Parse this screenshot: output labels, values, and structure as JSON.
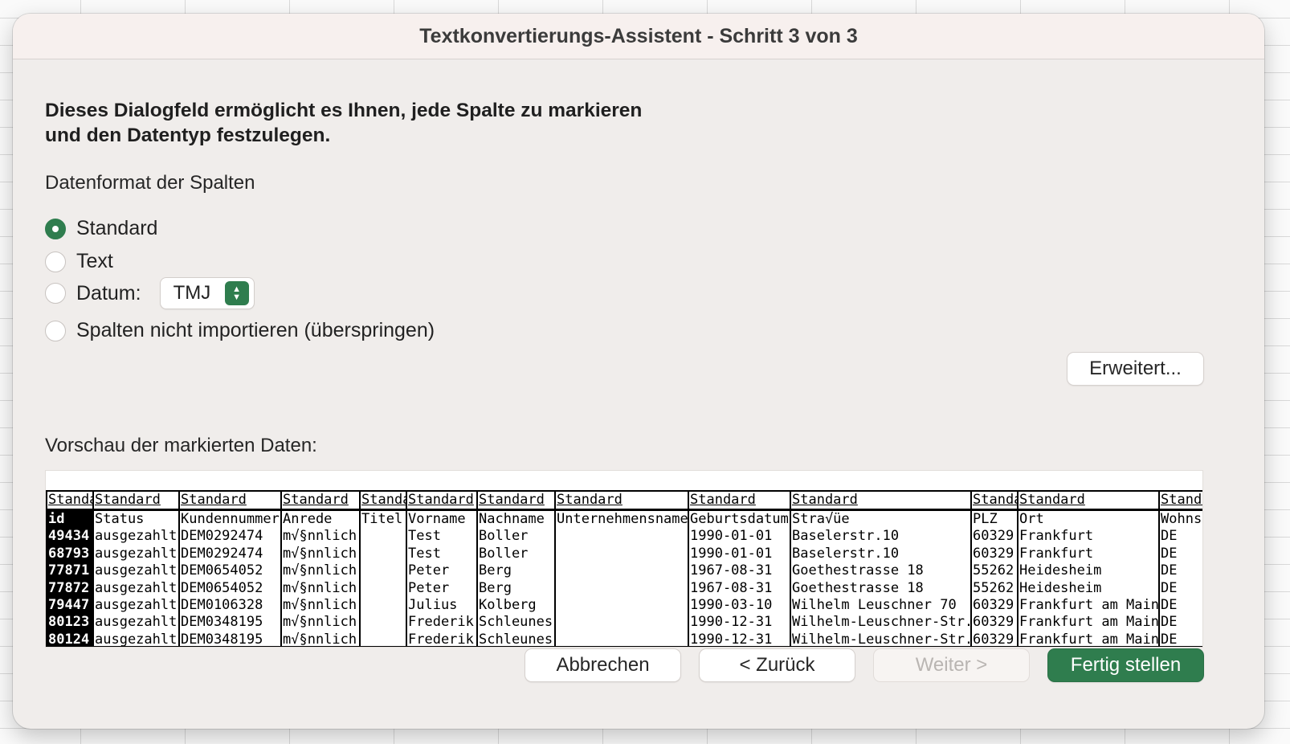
{
  "dialog": {
    "title": "Textkonvertierungs-Assistent - Schritt 3 von 3",
    "heading_line1": "Dieses Dialogfeld ermöglicht es Ihnen, jede Spalte zu markieren",
    "heading_line2": "und den Datentyp festzulegen.",
    "format_section_label": "Datenformat der Spalten",
    "options": [
      {
        "label": "Standard",
        "checked": true
      },
      {
        "label": "Text",
        "checked": false
      },
      {
        "label": "Datum:",
        "checked": false
      },
      {
        "label": "Spalten nicht importieren (überspringen)",
        "checked": false
      }
    ],
    "date_format_value": "TMJ",
    "advanced_button": "Erweitert...",
    "preview_label": "Vorschau der markierten Daten:",
    "buttons": {
      "cancel": "Abbrechen",
      "back": "< Zurück",
      "next": "Weiter >",
      "finish": "Fertig stellen"
    },
    "accent_color": "#2f7d4e"
  },
  "preview": {
    "columns": [
      {
        "type": "Standard",
        "cells": [
          "id",
          "49434",
          "68793",
          "77871",
          "77872",
          "79447",
          "80123",
          "80124"
        ]
      },
      {
        "type": "Standard",
        "cells": [
          "Status",
          "ausgezahlt",
          "ausgezahlt",
          "ausgezahlt",
          "ausgezahlt",
          "ausgezahlt",
          "ausgezahlt",
          "ausgezahlt"
        ]
      },
      {
        "type": "Standard",
        "cells": [
          "Kundennummer",
          "DEM0292474",
          "DEM0292474",
          "DEM0654052",
          "DEM0654052",
          "DEM0106328",
          "DEM0348195",
          "DEM0348195"
        ]
      },
      {
        "type": "Standard",
        "cells": [
          "Anrede",
          "m√§nnlich",
          "m√§nnlich",
          "m√§nnlich",
          "m√§nnlich",
          "m√§nnlich",
          "m√§nnlich",
          "m√§nnlich"
        ]
      },
      {
        "type": "Standard",
        "cells": [
          "Titel",
          "",
          "",
          "",
          "",
          "",
          "",
          ""
        ]
      },
      {
        "type": "Standard",
        "cells": [
          "Vorname",
          "Test",
          "Test",
          "Peter",
          "Peter",
          "Julius",
          "Frederik",
          "Frederik"
        ]
      },
      {
        "type": "Standard",
        "cells": [
          "Nachname",
          "Boller",
          "Boller",
          "Berg",
          "Berg",
          "Kolberg",
          "Schleunes",
          "Schleunes"
        ]
      },
      {
        "type": "Standard",
        "cells": [
          "Unternehmensname",
          "",
          "",
          "",
          "",
          "",
          "",
          ""
        ]
      },
      {
        "type": "Standard",
        "cells": [
          "Geburtsdatum",
          "1990-01-01",
          "1990-01-01",
          "1967-08-31",
          "1967-08-31",
          "1990-03-10",
          "1990-12-31",
          "1990-12-31"
        ]
      },
      {
        "type": "Standard",
        "cells": [
          "Stra√üe",
          "Baselerstr.10",
          "Baselerstr.10",
          "Goethestrasse 18",
          "Goethestrasse 18",
          "Wilhelm Leuschner 70",
          "Wilhelm-Leuschner-Str.",
          "Wilhelm-Leuschner-Str."
        ]
      },
      {
        "type": "Standard",
        "cells": [
          "PLZ",
          "60329",
          "60329",
          "55262",
          "55262",
          "60329",
          "60329",
          "60329"
        ]
      },
      {
        "type": "Standard",
        "cells": [
          "Ort",
          "Frankfurt",
          "Frankfurt",
          "Heidesheim",
          "Heidesheim",
          "Frankfurt am Main",
          "Frankfurt am Main",
          "Frankfurt am Main"
        ]
      },
      {
        "type": "Standard",
        "cells": [
          "Wohnsitz",
          "DE",
          "DE",
          "DE",
          "DE",
          "DE",
          "DE",
          "DE"
        ]
      }
    ]
  }
}
